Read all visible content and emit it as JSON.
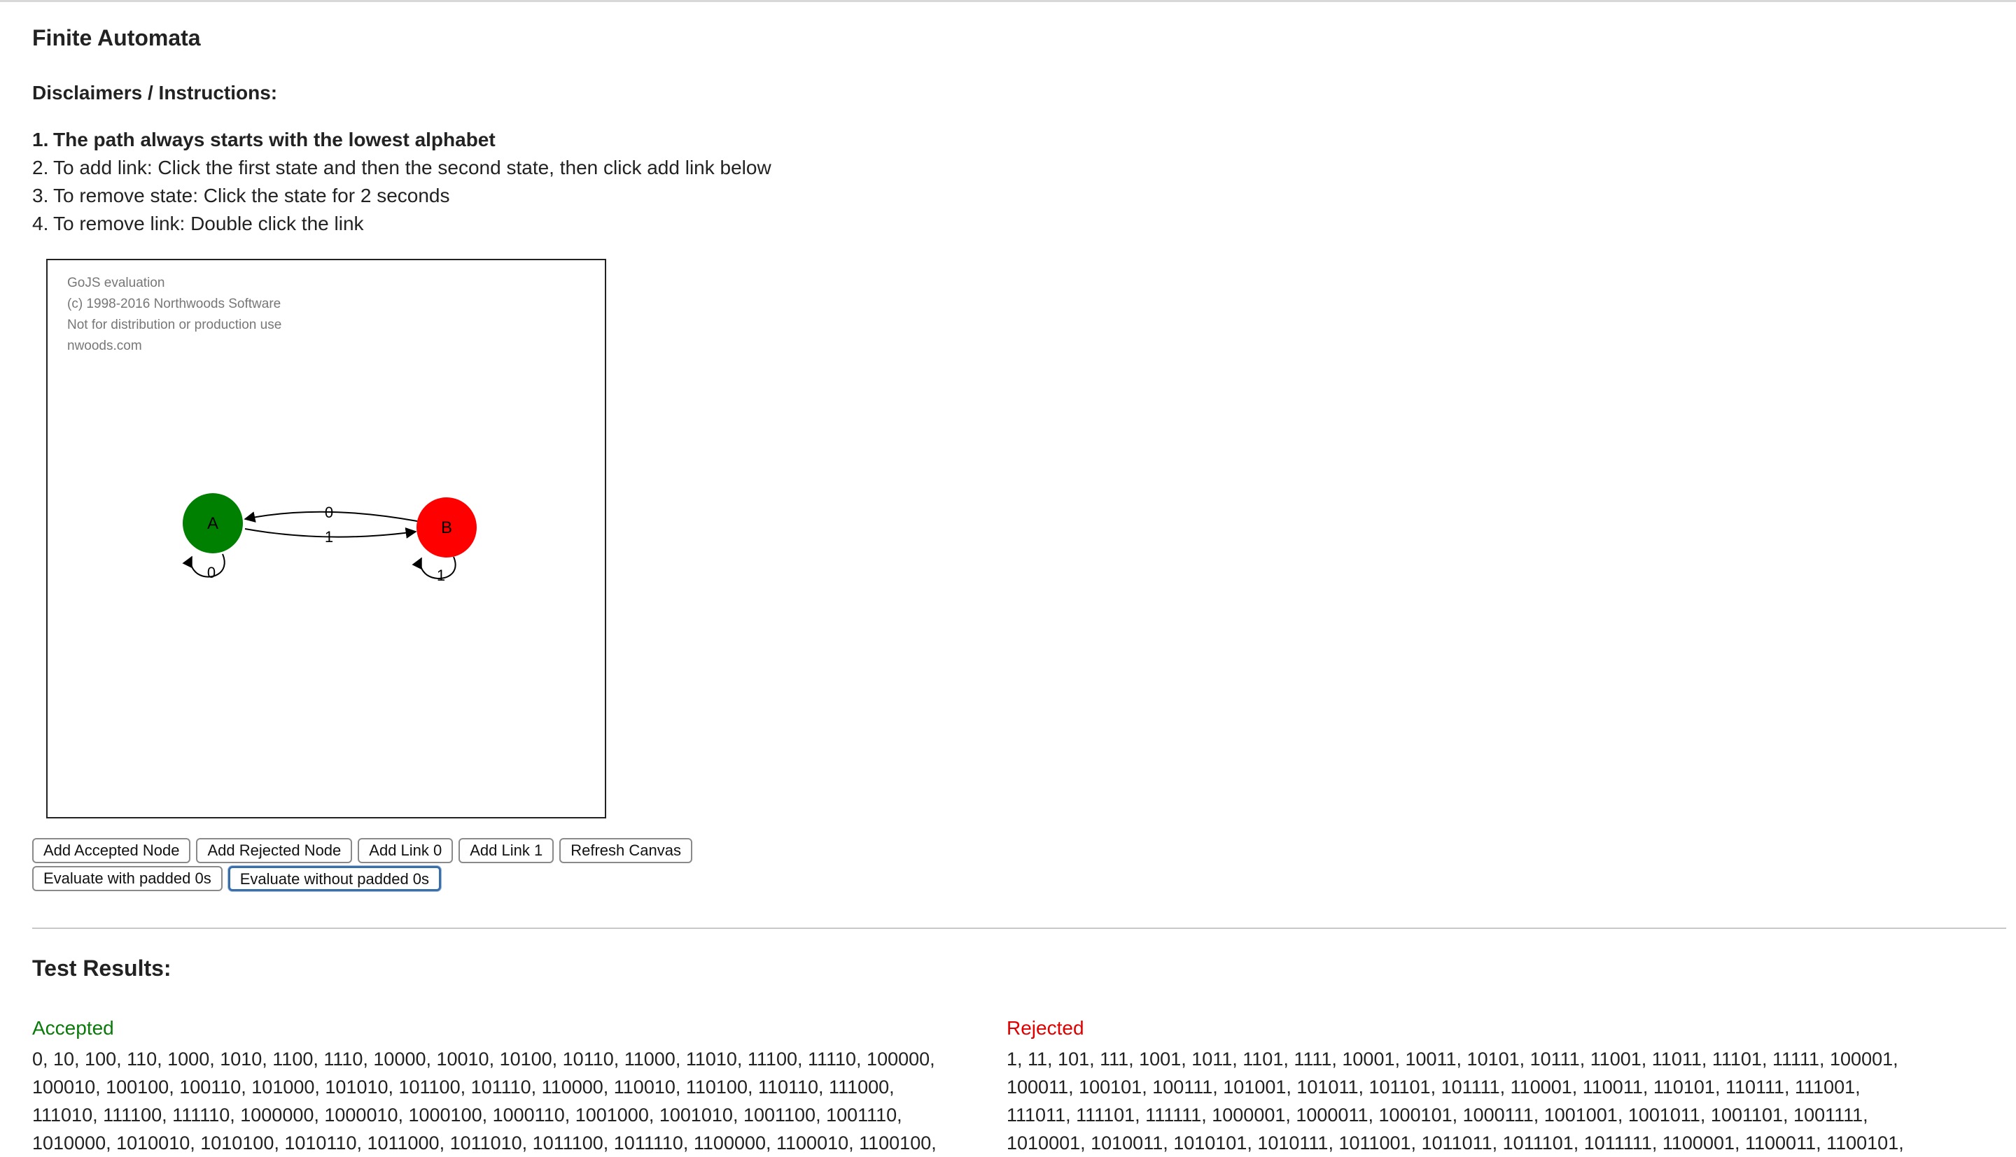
{
  "header": {
    "title": "Finite Automata",
    "instructions_heading": "Disclaimers / Instructions:"
  },
  "instructions": [
    {
      "num": "1.",
      "text": "The path always starts with the lowest alphabet"
    },
    {
      "num": "2.",
      "text": "To add link: Click the first state and then the second state, then click add link below"
    },
    {
      "num": "3.",
      "text": "To remove state: Click the state for 2 seconds"
    },
    {
      "num": "4.",
      "text": "To remove link: Double click the link"
    }
  ],
  "canvas": {
    "watermark": [
      "GoJS evaluation",
      "(c) 1998-2016 Northwoods Software",
      "Not for distribution or production use",
      "nwoods.com"
    ],
    "nodes": [
      {
        "id": "A",
        "label": "A",
        "accepted": true,
        "color": "#008000"
      },
      {
        "id": "B",
        "label": "B",
        "accepted": false,
        "color": "#ff0000"
      }
    ],
    "links": [
      {
        "from": "A",
        "to": "A",
        "label": "0"
      },
      {
        "from": "A",
        "to": "B",
        "label": "1"
      },
      {
        "from": "B",
        "to": "A",
        "label": "0"
      },
      {
        "from": "B",
        "to": "B",
        "label": "1"
      }
    ]
  },
  "buttons": {
    "add_accepted": "Add Accepted Node",
    "add_rejected": "Add Rejected Node",
    "add_link_0": "Add Link 0",
    "add_link_1": "Add Link 1",
    "refresh": "Refresh Canvas",
    "eval_padded": "Evaluate with padded 0s",
    "eval_unpadded": "Evaluate without padded 0s"
  },
  "results": {
    "heading": "Test Results:",
    "accepted_label": "Accepted",
    "rejected_label": "Rejected",
    "accepted_lines": [
      "0, 10, 100, 110, 1000, 1010, 1100, 1110, 10000, 10010, 10100, 10110, 11000, 11010, 11100, 11110, 100000,",
      "100010, 100100, 100110, 101000, 101010, 101100, 101110, 110000, 110010, 110100, 110110, 111000,",
      "111010, 111100, 111110, 1000000, 1000010, 1000100, 1000110, 1001000, 1001010, 1001100, 1001110,",
      "1010000, 1010010, 1010100, 1010110, 1011000, 1011010, 1011100, 1011110, 1100000, 1100010, 1100100,"
    ],
    "rejected_lines": [
      "1, 11, 101, 111, 1001, 1011, 1101, 1111, 10001, 10011, 10101, 10111, 11001, 11011, 11101, 11111, 100001,",
      "100011, 100101, 100111, 101001, 101011, 101101, 101111, 110001, 110011, 110101, 110111, 111001,",
      "111011, 111101, 111111, 1000001, 1000011, 1000101, 1000111, 1001001, 1001011, 1001101, 1001111,",
      "1010001, 1010011, 1010101, 1010111, 1011001, 1011011, 1011101, 1011111, 1100001, 1100011, 1100101,"
    ]
  }
}
